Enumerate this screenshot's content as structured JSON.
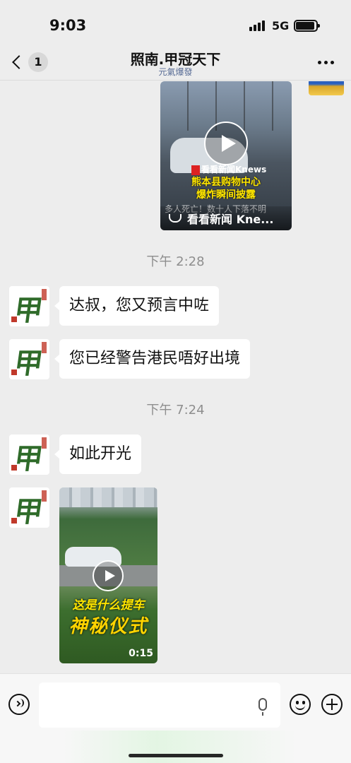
{
  "status_bar": {
    "time": "9:03",
    "network": "5G"
  },
  "nav": {
    "unread_count": "1",
    "title": "照南.甲冠天下",
    "subtitle": "元氣爆發"
  },
  "messages": {
    "sent_video": {
      "logo_text": "看看新闻Knews",
      "headline_line1": "熊本县购物中心",
      "headline_line2": "爆炸瞬间披露",
      "partial_line": "多人死亡！数十人下落不明",
      "channel_name": "看看新闻 Kne..."
    },
    "time_1": "下午 2:28",
    "msg_1": "达叔，您又预言中咗",
    "msg_2": "您已经警告港民唔好出境",
    "time_2": "下午 7:24",
    "msg_3": "如此开光",
    "recv_video": {
      "caption_line1": "这是什么提车",
      "caption_line2": "神秘仪式",
      "duration": "0:15"
    },
    "avatar_char": "甲"
  },
  "input": {
    "value": "",
    "placeholder": ""
  },
  "icons": {
    "back": "chevron-left-icon",
    "more": "ellipsis-icon",
    "voice": "voice-icon",
    "mic": "microphone-icon",
    "emoji": "emoji-icon",
    "plus": "plus-icon"
  }
}
